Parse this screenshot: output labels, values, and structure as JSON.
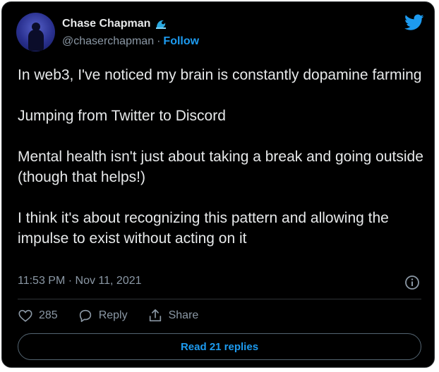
{
  "author": {
    "name": "Chase Chapman",
    "handle": "@chaserchapman",
    "separator": "·",
    "follow_label": "Follow",
    "badge_icon": "water-wave-icon"
  },
  "tweet": {
    "paragraphs": [
      "In web3, I've noticed my brain is constantly dopamine farming",
      "Jumping from Twitter to Discord",
      "Mental health isn't just about taking a break and going outside (though that helps!)",
      "I think it's about recognizing this pattern and allowing the impulse to exist without acting on it"
    ],
    "timestamp": "11:53 PM · Nov 11, 2021"
  },
  "actions": {
    "like_count": "285",
    "reply_label": "Reply",
    "share_label": "Share"
  },
  "footer": {
    "read_replies_label": "Read 21 replies"
  },
  "colors": {
    "background": "#000000",
    "text": "#e7e9ea",
    "secondary": "#8b98a5",
    "accent": "#1d9bf0"
  }
}
